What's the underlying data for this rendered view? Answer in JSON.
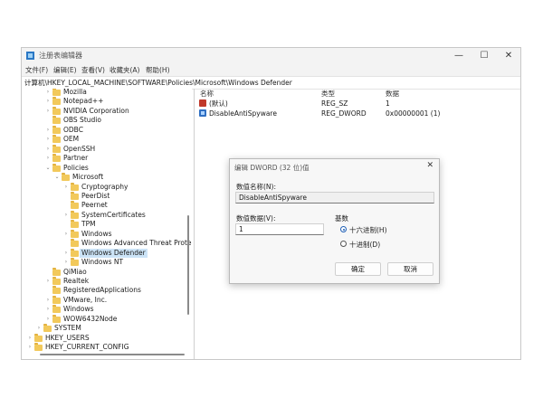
{
  "window": {
    "title": "注册表编辑器",
    "controls": {
      "minimize": "—",
      "maximize": "☐",
      "close": "✕"
    }
  },
  "menu": [
    "文件(F)",
    "编辑(E)",
    "查看(V)",
    "收藏夹(A)",
    "帮助(H)"
  ],
  "address": "计算机\\HKEY_LOCAL_MACHINE\\SOFTWARE\\Policies\\Microsoft\\Windows Defender",
  "tree": [
    {
      "label": "Mozilla",
      "toggle": "›"
    },
    {
      "label": "Notepad++",
      "toggle": "›"
    },
    {
      "label": "NVIDIA Corporation",
      "toggle": "›"
    },
    {
      "label": "OBS Studio",
      "toggle": ""
    },
    {
      "label": "ODBC",
      "toggle": "›"
    },
    {
      "label": "OEM",
      "toggle": "›"
    },
    {
      "label": "OpenSSH",
      "toggle": "›"
    },
    {
      "label": "Partner",
      "toggle": "›"
    },
    {
      "label": "Policies",
      "toggle": "⌄"
    },
    {
      "label": "Microsoft",
      "toggle": "⌄"
    },
    {
      "label": "Cryptography",
      "toggle": "›"
    },
    {
      "label": "PeerDist",
      "toggle": ""
    },
    {
      "label": "Peernet",
      "toggle": ""
    },
    {
      "label": "SystemCertificates",
      "toggle": "›"
    },
    {
      "label": "TPM",
      "toggle": ""
    },
    {
      "label": "Windows",
      "toggle": "›"
    },
    {
      "label": "Windows Advanced Threat Prote",
      "toggle": ""
    },
    {
      "label": "Windows Defender",
      "toggle": "›"
    },
    {
      "label": "Windows NT",
      "toggle": "›"
    },
    {
      "label": "QiMiao",
      "toggle": ""
    },
    {
      "label": "Realtek",
      "toggle": "›"
    },
    {
      "label": "RegisteredApplications",
      "toggle": ""
    },
    {
      "label": "VMware, Inc.",
      "toggle": "›"
    },
    {
      "label": "Windows",
      "toggle": "›"
    },
    {
      "label": "WOW6432Node",
      "toggle": "›"
    },
    {
      "label": "SYSTEM",
      "toggle": "›"
    },
    {
      "label": "HKEY_USERS",
      "toggle": "›"
    },
    {
      "label": "HKEY_CURRENT_CONFIG",
      "toggle": "›"
    }
  ],
  "selected_tree_item": "Windows Defender",
  "list": {
    "headers": [
      "名称",
      "类型",
      "数据"
    ],
    "rows": [
      {
        "name": "(默认)",
        "type": "REG_SZ",
        "data": "1",
        "icon": "ab-string-icon"
      },
      {
        "name": "DisableAntiSpyware",
        "type": "REG_DWORD",
        "data": "0x00000001 (1)",
        "icon": "binary-value-icon"
      }
    ]
  },
  "dialog": {
    "title": "编辑 DWORD (32 位)值",
    "close": "✕",
    "value_name_label": "数值名称(N):",
    "value_name": "DisableAntiSpyware",
    "value_data_label": "数值数据(V):",
    "value_data": "1",
    "base_label": "基数",
    "base_options": [
      "十六进制(H)",
      "十进制(D)"
    ],
    "base_selected": "十六进制(H)",
    "ok": "确定",
    "cancel": "取消"
  },
  "colors": {
    "accent": "#1f5fb5",
    "selection": "#cce4f7",
    "folder": "#f2c95b"
  }
}
